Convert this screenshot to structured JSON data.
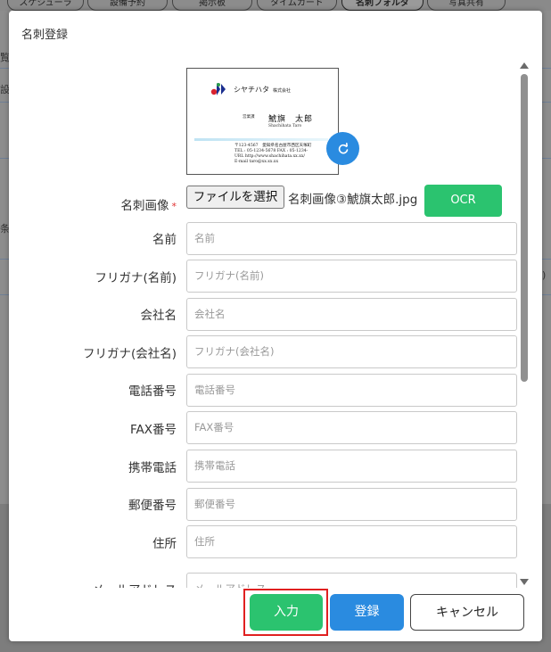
{
  "background": {
    "tabs": [
      "スケジューラ",
      "設備予約",
      "掲示板",
      "タイムカード",
      "名刺フォルダ",
      "写真共有"
    ],
    "active_tab": "名刺フォルダ",
    "fragments": {
      "a": "覧",
      "b": "設",
      "c": "条",
      "d": ")"
    }
  },
  "modal": {
    "title": "名刺登録"
  },
  "card": {
    "company": "シヤチハタ",
    "company_suffix": "株式会社",
    "dept": "営業課",
    "name": "鯱旗　太郎",
    "romaji": "Shachihata Taro",
    "info": [
      "〒123-4567　愛知県名古屋市西区天塚町",
      "TEL : 05-1234-5678 FAX : 05-1234-",
      "URL http://www.shachihata.xx.xx/",
      "E-mail taro@xx.xx.xx"
    ]
  },
  "form": {
    "image_label": "名刺画像",
    "required_mark": "*",
    "file_button": "ファイルを選択",
    "file_name": "名刺画像③鯱旗太郎.jpg",
    "ocr_button": "OCR",
    "fields": [
      {
        "label": "名前",
        "placeholder": "名前"
      },
      {
        "label": "フリガナ(名前)",
        "placeholder": "フリガナ(名前)"
      },
      {
        "label": "会社名",
        "placeholder": "会社名"
      },
      {
        "label": "フリガナ(会社名)",
        "placeholder": "フリガナ(会社名)"
      },
      {
        "label": "電話番号",
        "placeholder": "電話番号"
      },
      {
        "label": "FAX番号",
        "placeholder": "FAX番号"
      },
      {
        "label": "携帯電話",
        "placeholder": "携帯電話"
      },
      {
        "label": "郵便番号",
        "placeholder": "郵便番号"
      },
      {
        "label": "住所",
        "placeholder": "住所"
      },
      {
        "label": "メールアドレス",
        "placeholder": "メールアドレス"
      }
    ]
  },
  "footer": {
    "input_button": "入力",
    "register_button": "登録",
    "cancel_button": "キャンセル"
  },
  "colors": {
    "accent_green": "#2bc36f",
    "accent_blue": "#2a8be0",
    "highlight_red": "#e02020"
  }
}
